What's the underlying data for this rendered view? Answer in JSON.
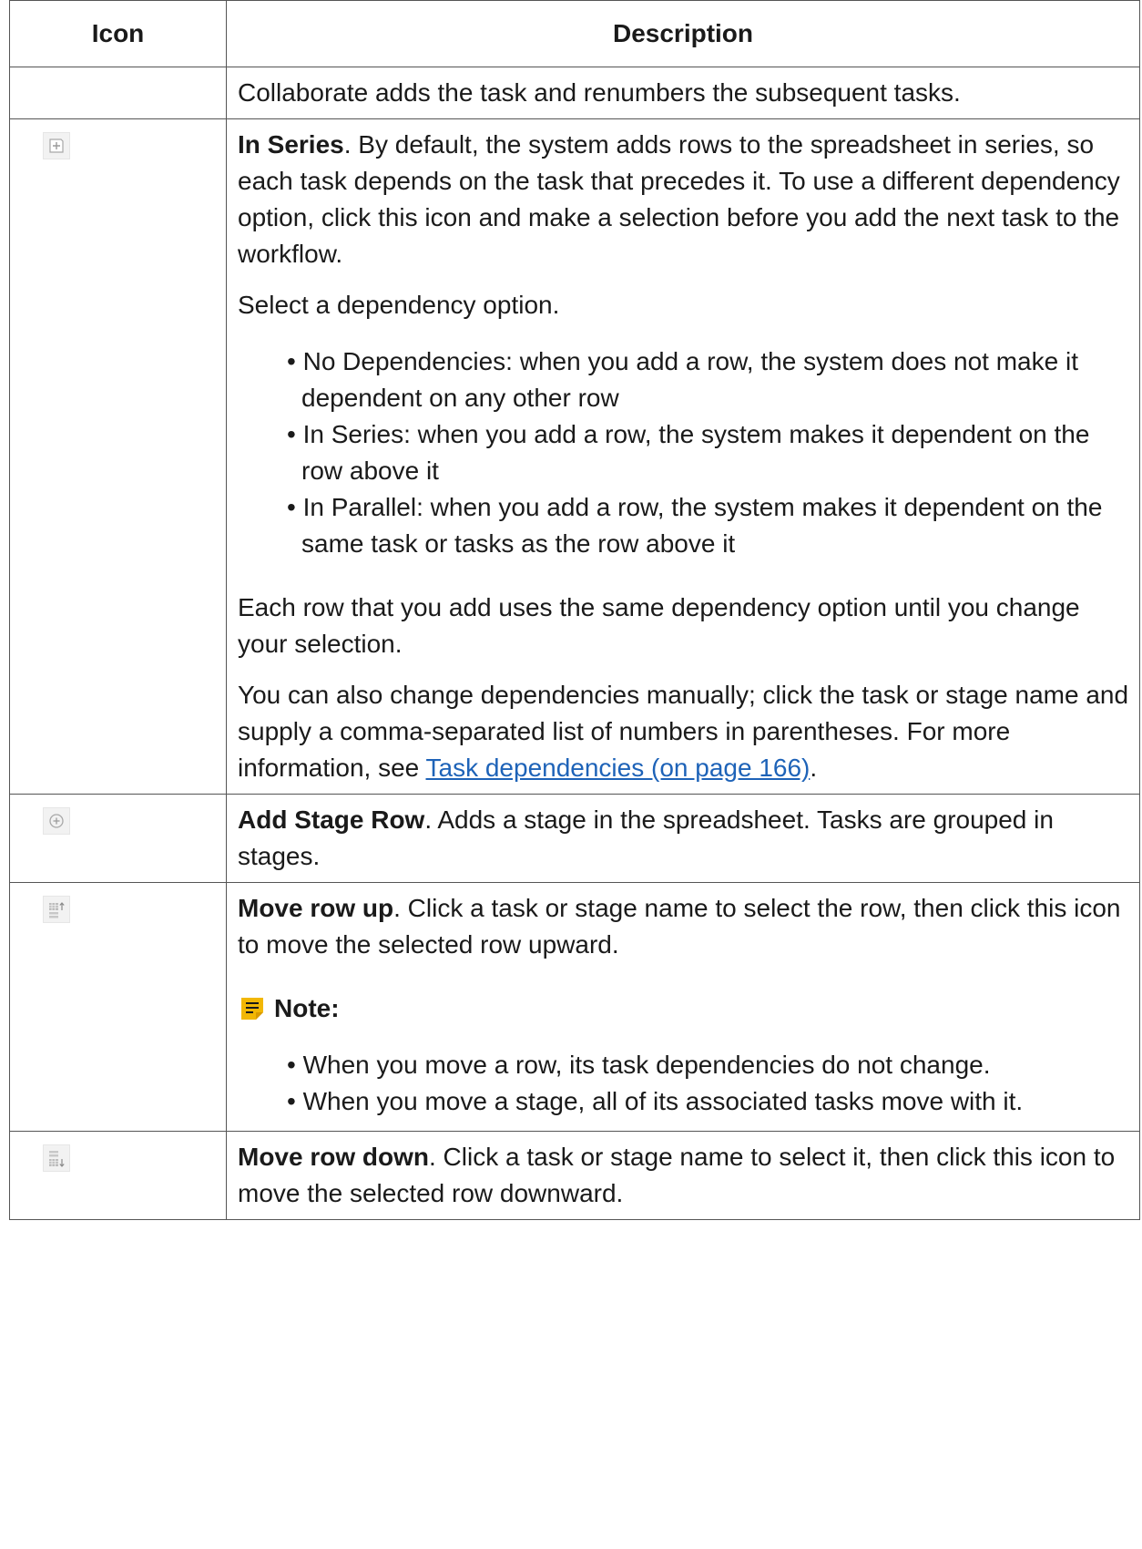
{
  "table": {
    "headers": {
      "icon": "Icon",
      "description": "Description"
    },
    "rows": [
      {
        "icon": "",
        "text": "Collaborate adds the task and renumbers the subsequent tasks."
      },
      {
        "icon": "add-in-series-icon",
        "title": "In Series",
        "intro": ". By default, the system adds rows to the spreadsheet in series, so each task depends on the task that precedes it. To use a different dependency option, click this icon and make a selection before you add the next task to the workflow.",
        "select_text": "Select a dependency option.",
        "bullets": [
          "No Dependencies: when you add a row, the system does not make it dependent on any other row",
          "In Series: when you add a row, the system makes it dependent on the row above it",
          "In Parallel: when you add a row, the system makes it dependent on the same task or tasks as the row above it"
        ],
        "after_text": "Each row that you add uses the same dependency option until you change your selection.",
        "manual_text": "You can also change dependencies manually; click the task or stage name and supply a comma-separated list of numbers in parentheses. For more information, see ",
        "link_text": "Task dependencies (on page 166)",
        "link_suffix": "."
      },
      {
        "icon": "add-stage-row-icon",
        "title": "Add Stage Row",
        "text": ". Adds a stage in the spreadsheet. Tasks are grouped in stages."
      },
      {
        "icon": "move-row-up-icon",
        "title": "Move row up",
        "text": ". Click a task or stage name to select the row, then click this icon to move the selected row upward.",
        "note_label": "Note:",
        "note_bullets": [
          "When you move a row, its task dependencies do not change.",
          "When you move a stage, all of its associated tasks move with it."
        ]
      },
      {
        "icon": "move-row-down-icon",
        "title": "Move row down",
        "text": ". Click a task or stage name to select it, then click this icon to move the selected row downward."
      }
    ]
  },
  "colors": {
    "link": "#1e63b8",
    "border": "#555555",
    "note_icon": "#f2b705"
  }
}
